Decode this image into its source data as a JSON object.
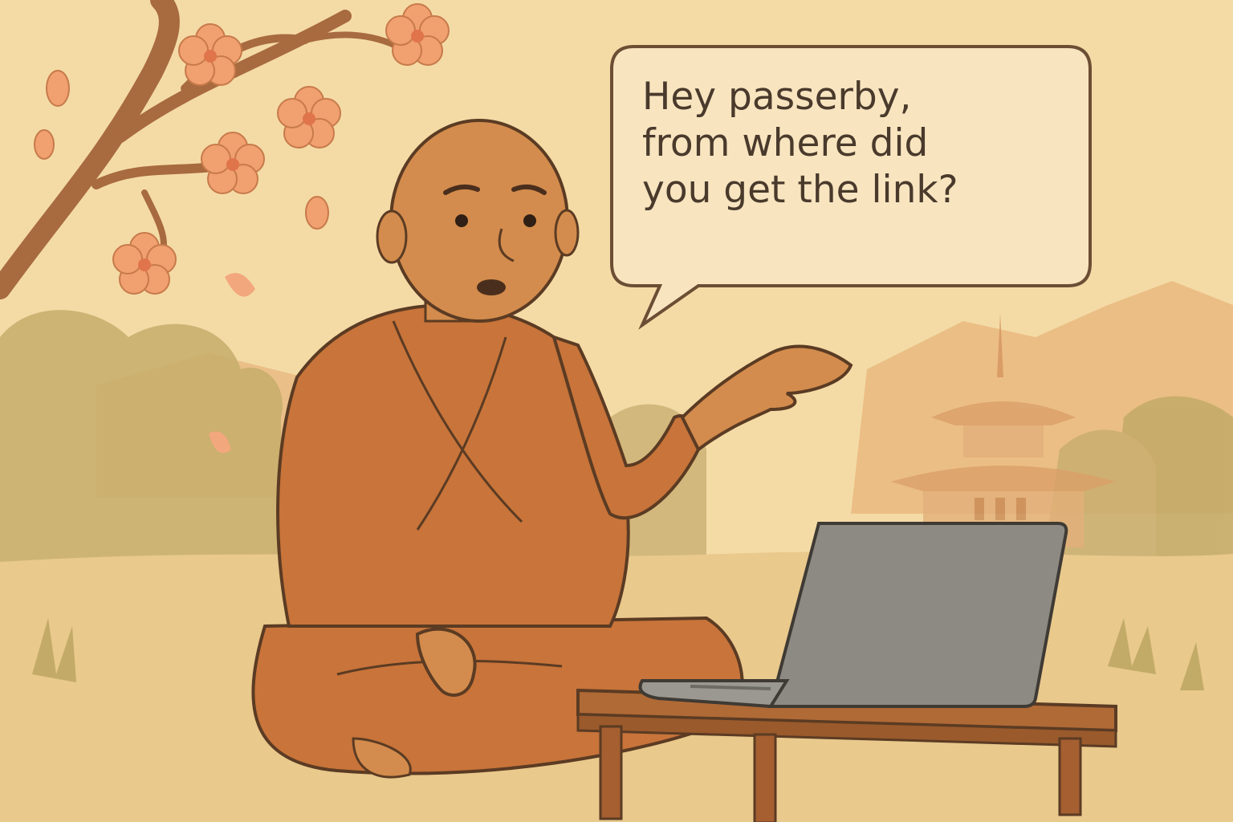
{
  "speech_bubble": {
    "lines": [
      "Hey passerby,",
      "from where did",
      "you get the link?"
    ]
  },
  "colors": {
    "background": "#f3d9a2",
    "robe": "#c8743a",
    "skin": "#d38c4d",
    "blossom": "#f1a070",
    "laptop": "#8d8a84",
    "table": "#b06a36",
    "outline": "#5b3b23"
  }
}
